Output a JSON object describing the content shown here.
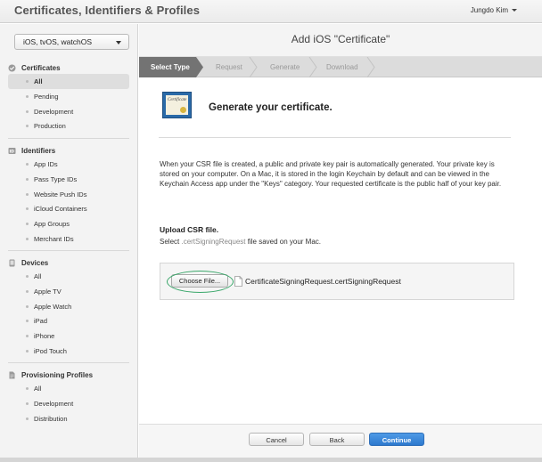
{
  "header": {
    "app_title": "Certificates, Identifiers & Profiles",
    "user_name": "Jungdo Kim"
  },
  "sidebar": {
    "platform_select": "iOS, tvOS, watchOS",
    "sections": [
      {
        "title": "Certificates",
        "icon": "check-circle-icon",
        "items": [
          "All",
          "Pending",
          "Development",
          "Production"
        ],
        "active_item": "All"
      },
      {
        "title": "Identifiers",
        "icon": "id-badge-icon",
        "items": [
          "App IDs",
          "Pass Type IDs",
          "Website Push IDs",
          "iCloud Containers",
          "App Groups",
          "Merchant IDs"
        ]
      },
      {
        "title": "Devices",
        "icon": "device-icon",
        "items": [
          "All",
          "Apple TV",
          "Apple Watch",
          "iPad",
          "iPhone",
          "iPod Touch"
        ]
      },
      {
        "title": "Provisioning Profiles",
        "icon": "document-icon",
        "items": [
          "All",
          "Development",
          "Distribution"
        ]
      }
    ]
  },
  "main": {
    "page_title": "Add iOS \"Certificate\"",
    "steps": [
      "Select Type",
      "Request",
      "Generate",
      "Download"
    ],
    "active_step": "Select Type",
    "cert_image_text": "Certificate",
    "cert_heading": "Generate your certificate.",
    "description": "When your CSR file is created, a public and private key pair is automatically generated. Your private key is stored on your computer. On a Mac, it is stored in the login Keychain by default and can be viewed in the Keychain Access app under the \"Keys\" category. Your requested certificate is the public half of your key pair.",
    "upload_title": "Upload CSR file.",
    "upload_sub_prefix": "Select",
    "upload_sub_ext": ".certSigningRequest",
    "upload_sub_suffix": "file saved on your Mac.",
    "choose_file_label": "Choose File...",
    "file_name": "CertificateSigningRequest.certSigningRequest"
  },
  "footer": {
    "cancel_label": "Cancel",
    "back_label": "Back",
    "continue_label": "Continue"
  },
  "colors": {
    "accent": "#2d79ce",
    "active_step": "#737373",
    "highlight_ring": "#3aa76a"
  }
}
